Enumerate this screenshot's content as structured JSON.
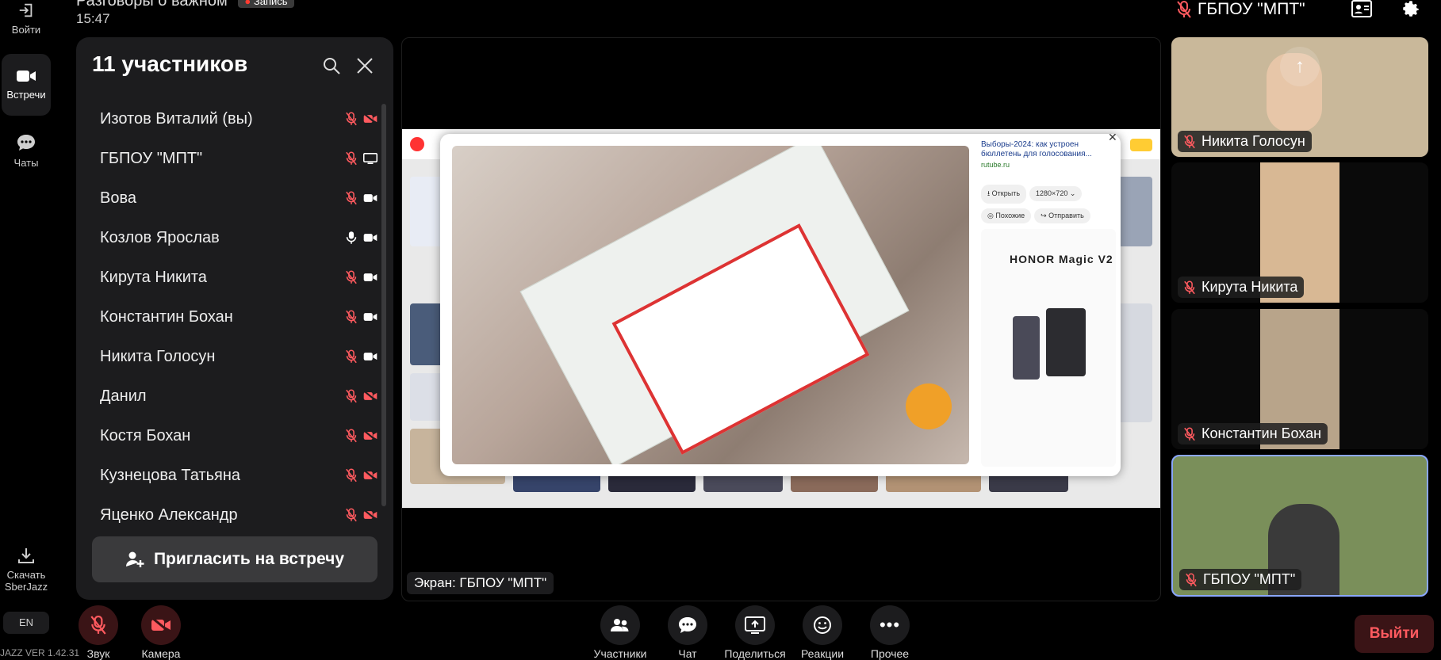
{
  "header": {
    "meeting_title": "Разговоры о важном",
    "rec_badge": "Запись",
    "time": "15:47",
    "host_name": "ГБПОУ \"МПТ\""
  },
  "rail": {
    "login": "Войти",
    "meetings": "Встречи",
    "chats": "Чаты",
    "download_line1": "Скачать",
    "download_line2": "SberJazz",
    "lang": "EN",
    "version": "JAZZ VER 1.42.31"
  },
  "participants_panel": {
    "title": "11 участников",
    "participants": [
      {
        "name": "Изотов Виталий (вы)",
        "mic": "muted",
        "cam": "off"
      },
      {
        "name": "ГБПОУ \"МПТ\"",
        "mic": "muted",
        "cam": "screen"
      },
      {
        "name": "Вова",
        "mic": "muted",
        "cam": "on"
      },
      {
        "name": "Козлов Ярослав",
        "mic": "on",
        "cam": "on"
      },
      {
        "name": "Кирута Никита",
        "mic": "muted",
        "cam": "on"
      },
      {
        "name": "Константин Бохан",
        "mic": "muted",
        "cam": "on"
      },
      {
        "name": "Никита Голосун",
        "mic": "muted",
        "cam": "on"
      },
      {
        "name": "Данил",
        "mic": "muted",
        "cam": "off"
      },
      {
        "name": "Костя Бохан",
        "mic": "muted",
        "cam": "off"
      },
      {
        "name": "Кузнецова Татьяна",
        "mic": "muted",
        "cam": "off"
      },
      {
        "name": "Яценко Александр",
        "mic": "muted",
        "cam": "off"
      }
    ],
    "invite_label": "Пригласить на встречу"
  },
  "stage": {
    "screen_label": "Экран: ГБПОУ \"МПТ\"",
    "popup": {
      "title": "Выборы-2024: как устроен бюллетень для голосования...",
      "source": "rutube.ru",
      "open_label": "Открыть",
      "size_label": "1280×720",
      "similar_label": "Похожие",
      "send_label": "Отправить",
      "ad_brand": "HONOR Magic V2"
    }
  },
  "tiles": [
    {
      "name": "Никита Голосун"
    },
    {
      "name": "Кирута Никита"
    },
    {
      "name": "Константин Бохан"
    },
    {
      "name": "ГБПОУ \"МПТ\""
    }
  ],
  "bottom_bar": {
    "sound": "Звук",
    "camera": "Камера",
    "participants": "Участники",
    "chat": "Чат",
    "share": "Поделиться",
    "reactions": "Реакции",
    "more": "Прочее",
    "leave": "Выйти"
  },
  "colors": {
    "muted_red": "#ff5a5f",
    "panel_bg": "#1c1c1e",
    "active_tile_border": "#8aa6ff"
  }
}
